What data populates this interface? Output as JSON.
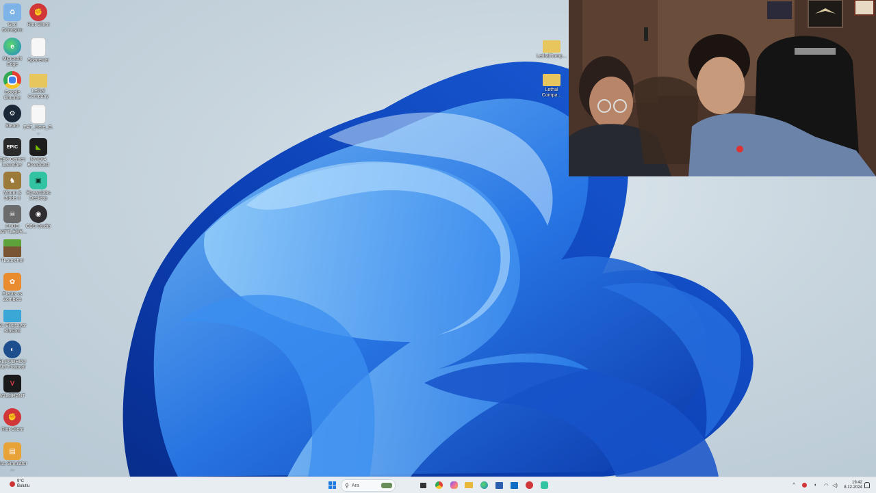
{
  "desktop_icons": [
    {
      "label": "Geri Dönüşüm",
      "color": "#5b9bd5",
      "icon": "recycle-bin-icon"
    },
    {
      "label": "Riot Client",
      "color": "#d13639",
      "icon": "riot-client-icon"
    },
    {
      "label": "Microsoft Edge",
      "color": "#1e88c8",
      "icon": "edge-icon"
    },
    {
      "label": "Spacewar",
      "color": "#f2f2f2",
      "icon": "document-icon"
    },
    {
      "label": "Google Chrome",
      "color": "#e44134",
      "icon": "chrome-icon"
    },
    {
      "label": "Lethal Company",
      "color": "#e7c65e",
      "icon": "folder-icon"
    },
    {
      "label": "Steam",
      "color": "#1b2838",
      "icon": "steam-icon"
    },
    {
      "label": "EAT_Here_G...",
      "color": "#f2f2f2",
      "icon": "document-icon"
    },
    {
      "label": "Epic Games Launcher",
      "color": "#2a2a2a",
      "icon": "epic-games-icon"
    },
    {
      "label": "NVIDIA Broadcast",
      "color": "#5a8f1e",
      "icon": "nvidia-icon"
    },
    {
      "label": "Mount & Blade II",
      "color": "#9c7b3a",
      "icon": "bannerlord-icon"
    },
    {
      "label": "Streamlabs Desktop",
      "color": "#31c3a2",
      "icon": "streamlabs-icon"
    },
    {
      "label": "PUBG BATTLEGR...",
      "color": "#6b6b6b",
      "icon": "pubg-icon"
    },
    {
      "label": "OBS Studio",
      "color": "#302e31",
      "icon": "obs-icon"
    },
    {
      "label": "TLauncher",
      "color": "#4f7a2a",
      "icon": "tlauncher-icon"
    },
    {
      "label": "Plants vs Zombies",
      "color": "#e98c2f",
      "icon": "game-icon"
    },
    {
      "label": "Bu Bilgisayar Klasörü",
      "color": "#3aa7d6",
      "icon": "monitor-icon"
    },
    {
      "label": "BLOODHOUND Protocol",
      "color": "#1d4f8f",
      "icon": "game-icon"
    },
    {
      "label": "VALORANT",
      "color": "#d6394a",
      "icon": "valorant-icon"
    },
    {
      "label": "Riot Client",
      "color": "#d13639",
      "icon": "riot-client-icon"
    },
    {
      "label": "Bus Simulator ...",
      "color": "#e7a238",
      "icon": "bus-icon"
    }
  ],
  "right_icons": [
    {
      "label": "LethalComp...",
      "color": "#e7c65e"
    },
    {
      "label": "Lethal Compa...",
      "color": "#e7c65e"
    }
  ],
  "taskbar": {
    "weather_temp": "9°C",
    "weather_desc": "Bulutlu",
    "search_placeholder": "Ara",
    "time": "19:42",
    "date": "8.12.2024"
  },
  "colors": {
    "bloom_dark": "#0b3fb8",
    "bloom_mid": "#1f6fe6",
    "bloom_light": "#5fb3f5",
    "taskbar_bg": "#e8edf2"
  }
}
